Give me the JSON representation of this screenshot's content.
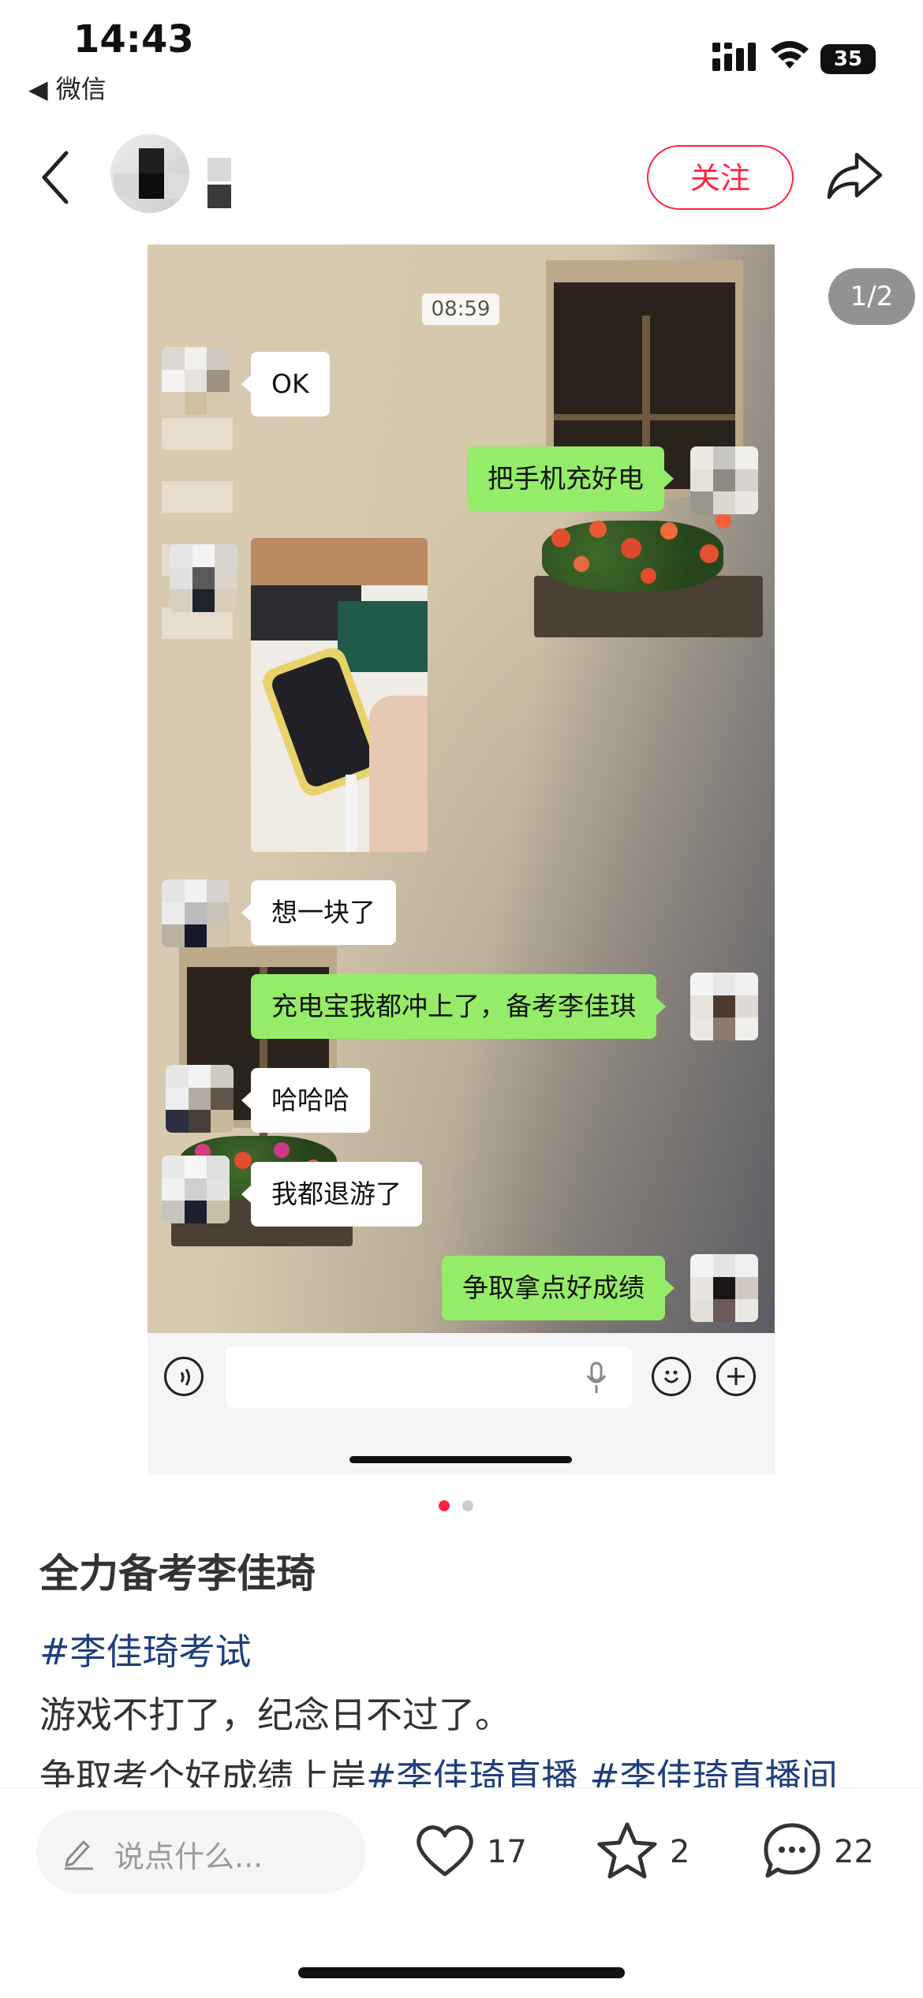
{
  "status_bar": {
    "time": "14:43",
    "back_app_label": "◀ 微信",
    "battery": "35"
  },
  "nav": {
    "follow_label": "关注"
  },
  "image_viewer": {
    "page_counter": "1/2",
    "chat": {
      "timestamp": "08:59",
      "messages": [
        {
          "side": "left",
          "text": "OK"
        },
        {
          "side": "right",
          "text": "把手机充好电"
        },
        {
          "side": "left",
          "type": "photo",
          "text": ""
        },
        {
          "side": "left",
          "text": "想一块了"
        },
        {
          "side": "right",
          "text": "充电宝我都冲上了，备考李佳琪"
        },
        {
          "side": "left",
          "text": "哈哈哈"
        },
        {
          "side": "left",
          "text": "我都退游了"
        },
        {
          "side": "right",
          "text": "争取拿点好成绩"
        }
      ]
    },
    "page_dots": {
      "count": 2,
      "active": 0,
      "active_color": "#ff2442",
      "inactive_color": "#cccccc"
    }
  },
  "post": {
    "title": "全力备考李佳琦",
    "tag_line": "#李佳琦考试",
    "line1": "游戏不打了，纪念日不过了。",
    "line2_text": "争取考个好成绩上岸",
    "line2_tag1": "#李佳琦直播",
    "line2_tag2": "#李佳琦直播间"
  },
  "bottom_bar": {
    "comment_placeholder": "说点什么...",
    "likes": "17",
    "favorites": "2",
    "comments": "22"
  },
  "colors": {
    "accent": "#ff2442",
    "tag": "#1e3f7a",
    "wechat_green": "#95ec69"
  }
}
